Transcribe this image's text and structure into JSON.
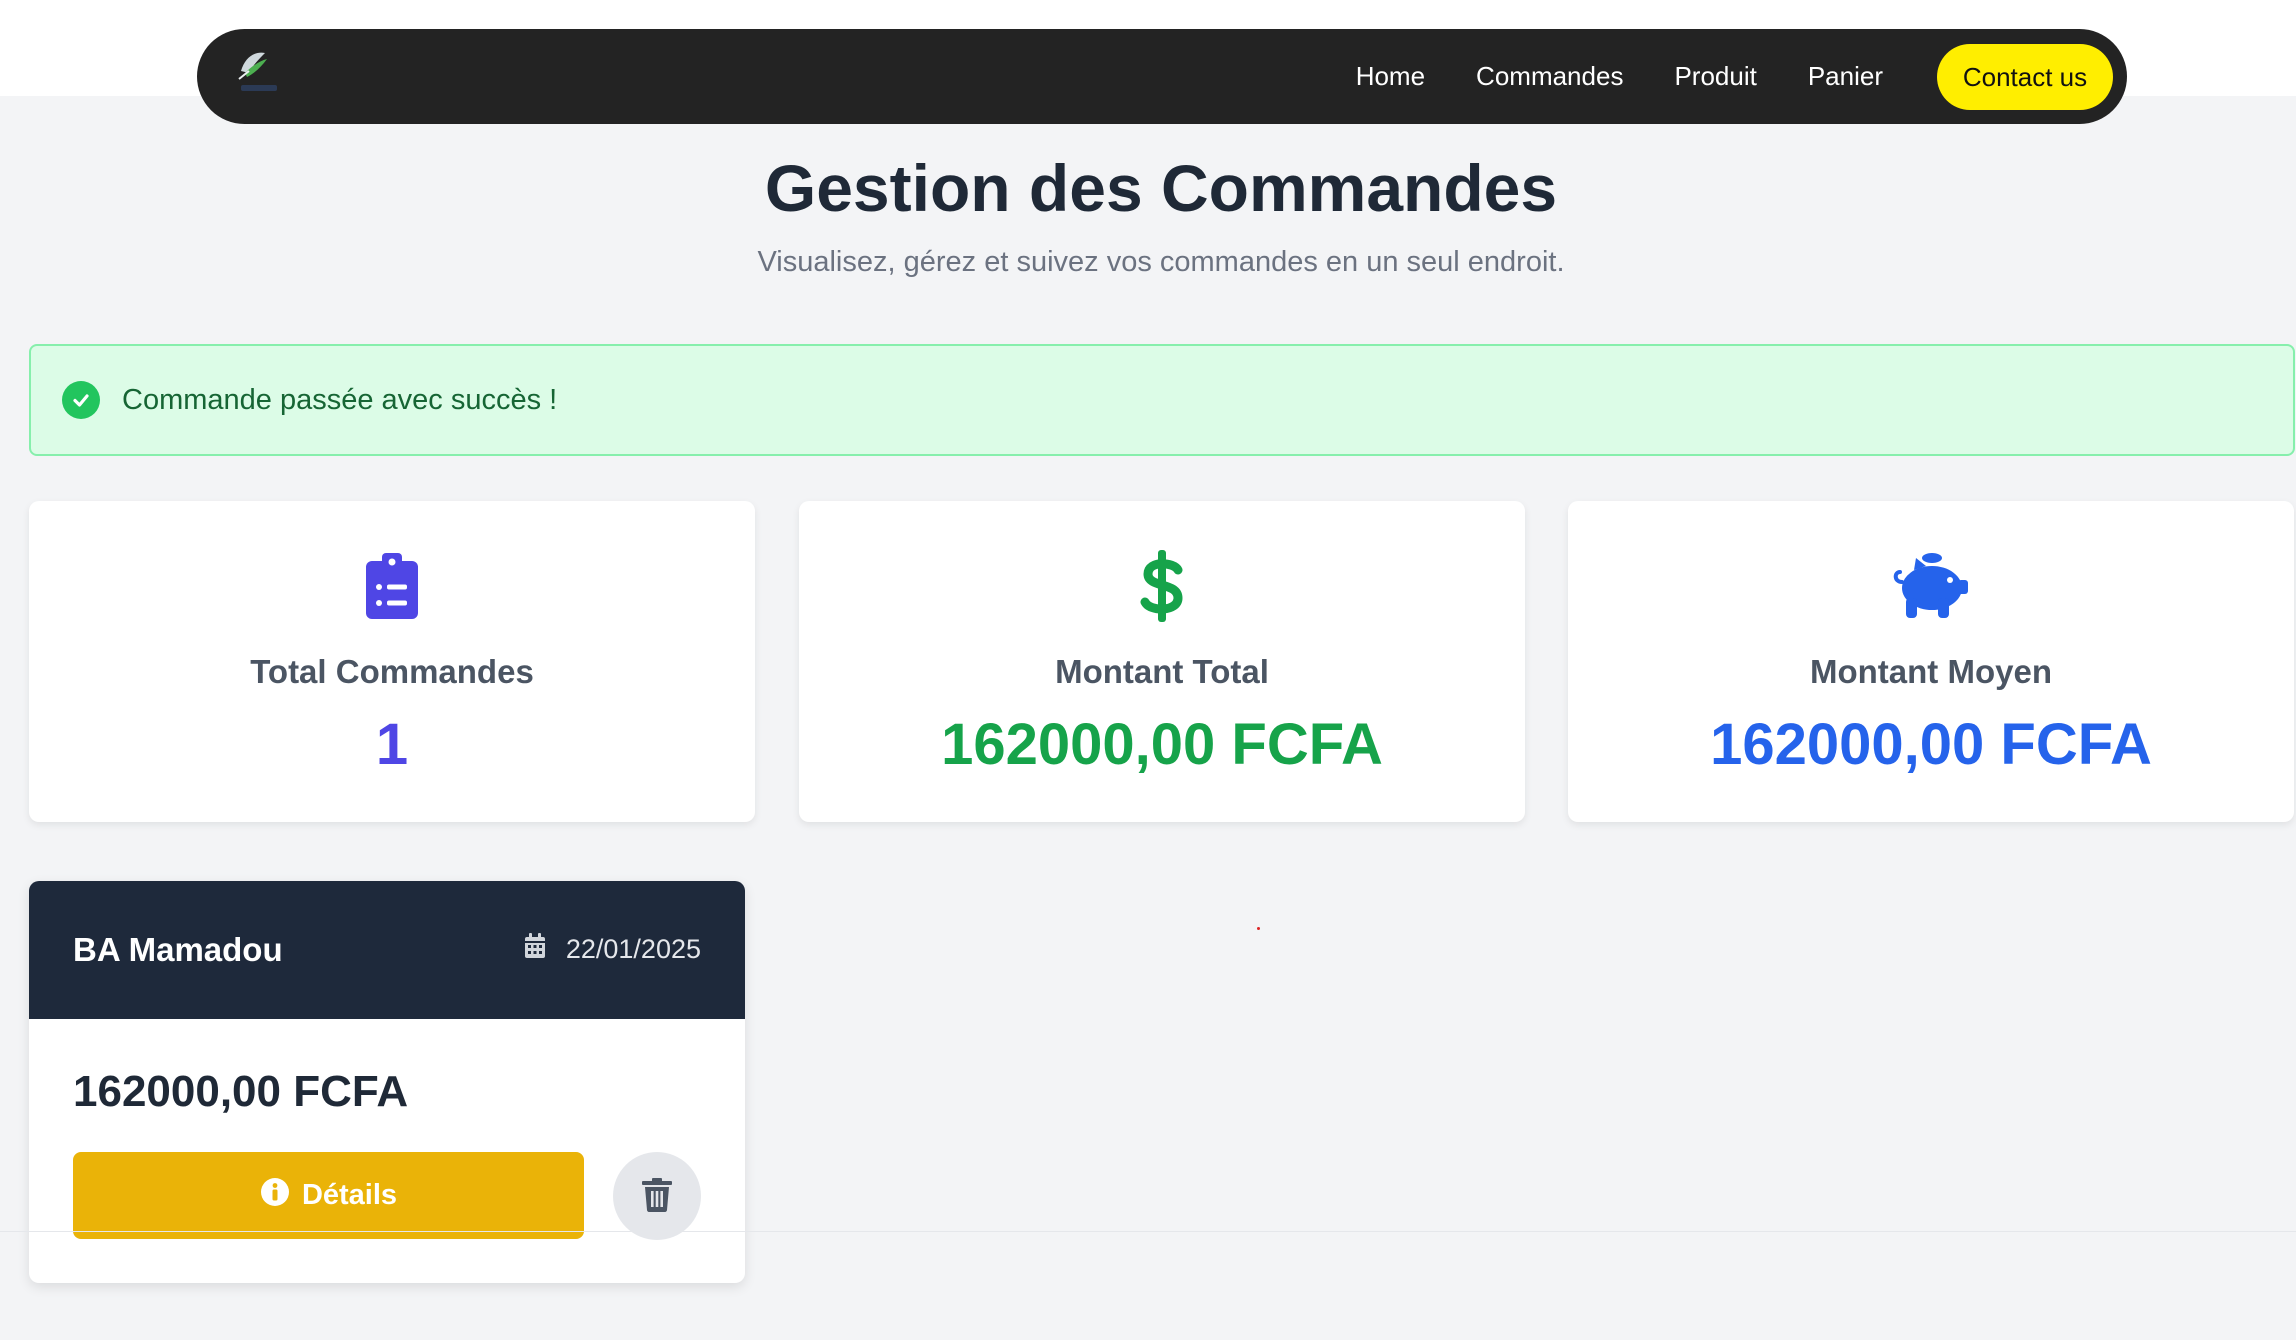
{
  "nav": {
    "logo_icon": "feather-logo-icon",
    "links": [
      "Home",
      "Commandes",
      "Produit",
      "Panier"
    ],
    "contact_label": "Contact us",
    "contact_color": "#ffee00"
  },
  "header": {
    "title": "Gestion des Commandes",
    "subtitle": "Visualisez, gérez et suivez vos commandes en un seul endroit."
  },
  "alert": {
    "icon": "check-circle-icon",
    "message": "Commande passée avec succès !"
  },
  "stats": [
    {
      "icon": "clipboard-list-icon",
      "label": "Total Commandes",
      "value": "1",
      "color": "#4f46e5"
    },
    {
      "icon": "dollar-icon",
      "label": "Montant Total",
      "value": "162000,00 FCFA",
      "color": "#16a34a"
    },
    {
      "icon": "piggy-bank-icon",
      "label": "Montant Moyen",
      "value": "162000,00 FCFA",
      "color": "#2563eb"
    }
  ],
  "orders": [
    {
      "client": "BA Mamadou",
      "date_icon": "calendar-icon",
      "date": "22/01/2025",
      "amount": "162000,00 FCFA",
      "details_icon": "info-icon",
      "details_label": "Détails",
      "delete_icon": "trash-icon"
    }
  ]
}
